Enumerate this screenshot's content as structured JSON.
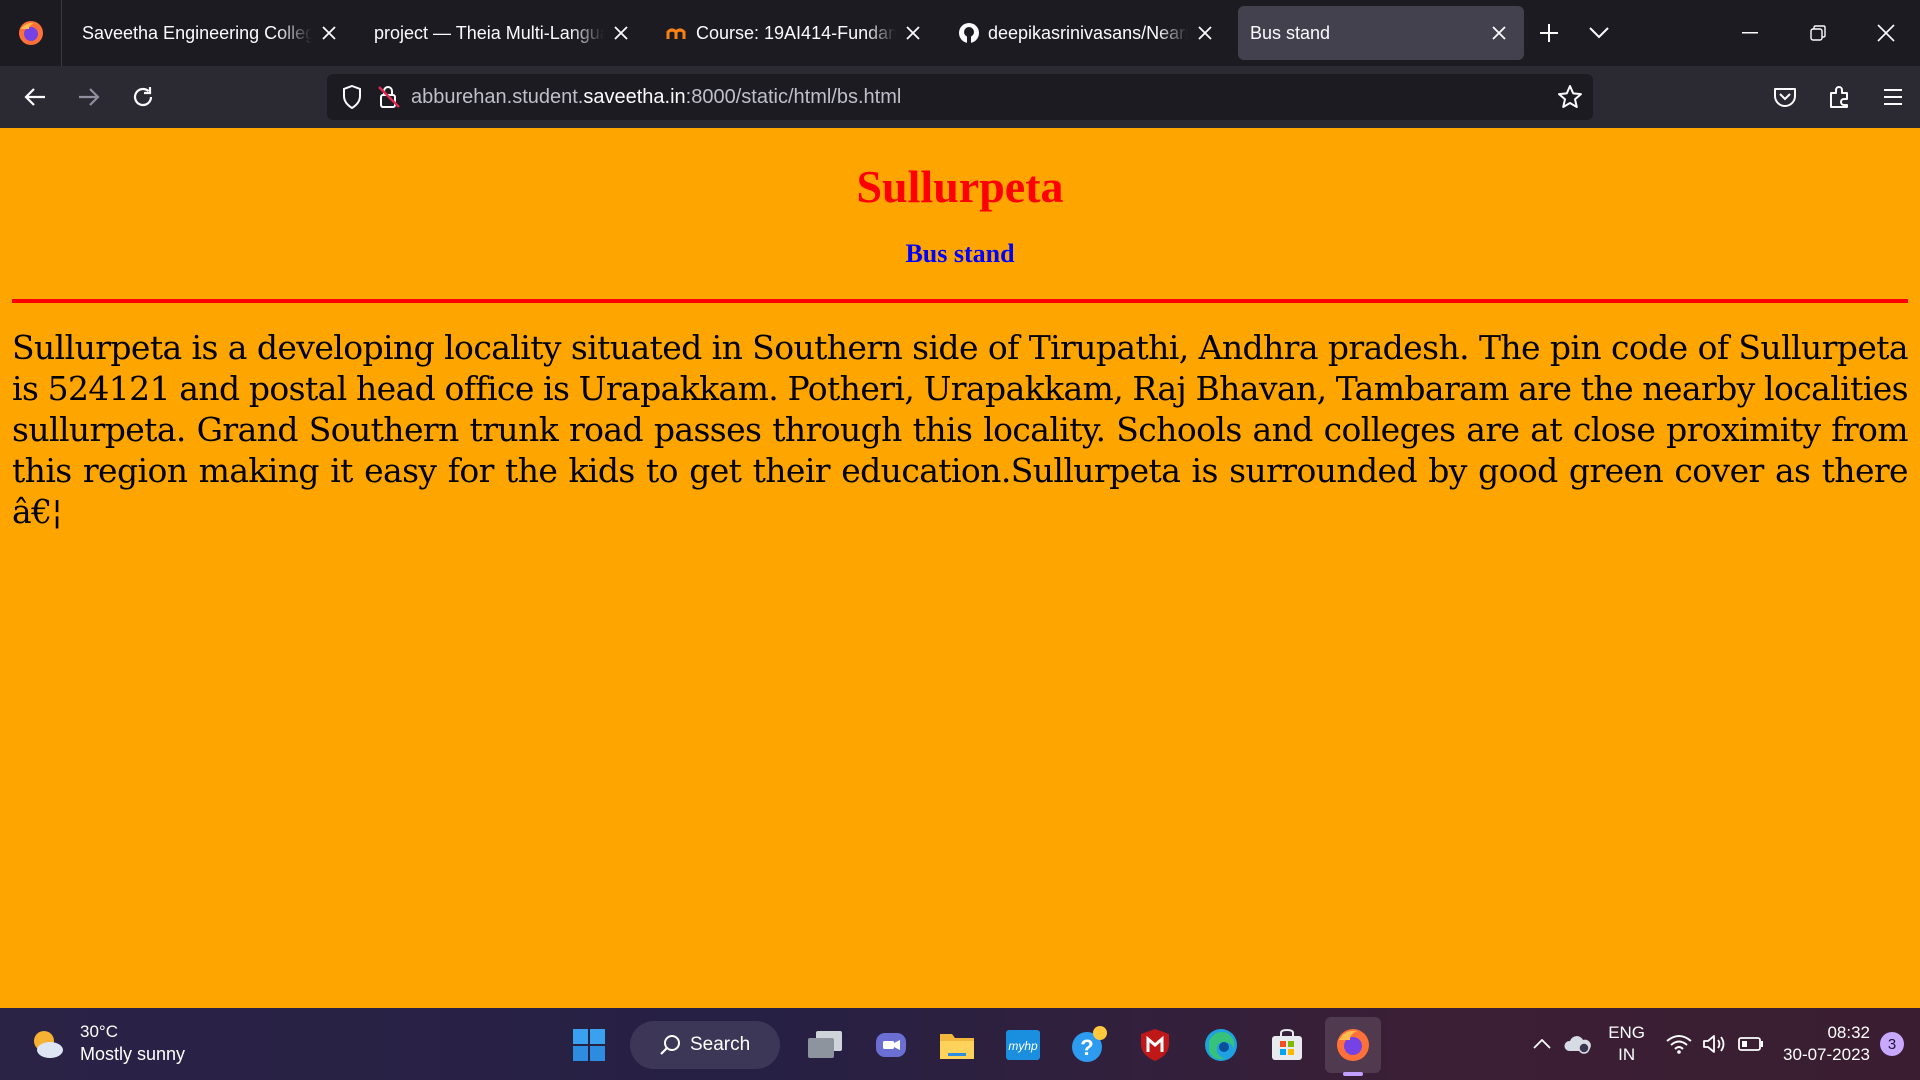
{
  "browser": {
    "tabs": [
      {
        "title": "Saveetha Engineering College",
        "icon": "none"
      },
      {
        "title": "project — Theia Multi-Language",
        "icon": "none"
      },
      {
        "title": "Course: 19AI414-Fundamentals",
        "icon": "moodle-icon"
      },
      {
        "title": "deepikasrinivasans/NearMe",
        "icon": "github-icon"
      },
      {
        "title": "Bus stand",
        "icon": "none",
        "active": true
      }
    ],
    "url_prefix": "abburehan.student.",
    "url_domain": "saveetha.in",
    "url_suffix": ":8000/static/html/bs.html"
  },
  "page": {
    "heading": "Sullurpeta",
    "subheading": "Bus stand",
    "paragraph": "Sullurpeta is a developing locality situated in Southern side of Tirupathi, Andhra pradesh. The pin code of Sullurpeta is 524121 and postal head office is Urapakkam. Potheri, Urapakkam, Raj Bhavan, Tambaram are the nearby localities sullurpeta. Grand Southern trunk road passes through this locality. Schools and colleges are at close proximity from this region making it easy for the kids to get their education.Sullurpeta is surrounded by good green cover as there â€¦",
    "background_color": "#ffa500",
    "heading_color": "#ff0000",
    "subheading_color": "#0000ff",
    "rule_color": "#ff0000"
  },
  "taskbar": {
    "weather_temp": "30°C",
    "weather_desc": "Mostly sunny",
    "search_label": "Search",
    "lang_line1": "ENG",
    "lang_line2": "IN",
    "time": "08:32",
    "date": "30-07-2023",
    "notification_count": "3"
  }
}
